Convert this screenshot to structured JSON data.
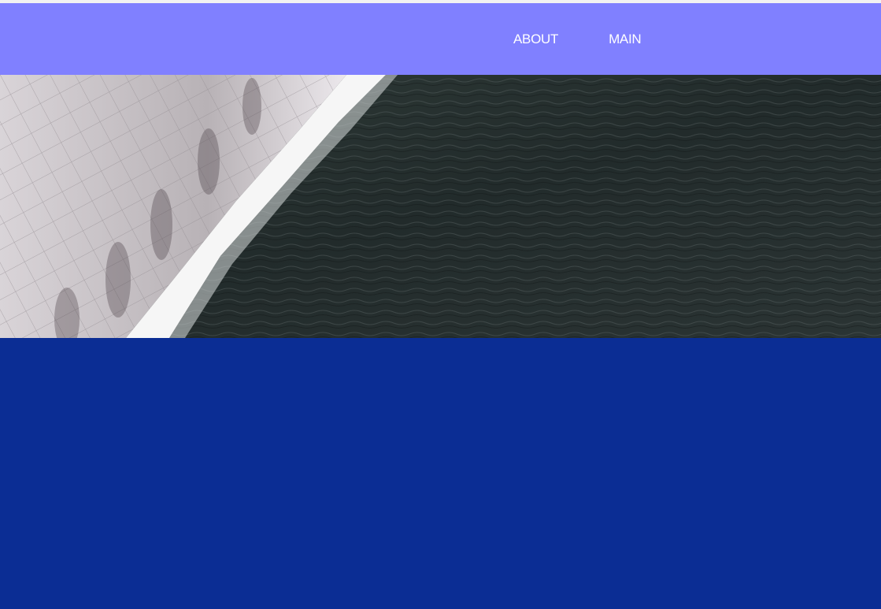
{
  "nav": {
    "items": [
      {
        "label": "ABOUT"
      },
      {
        "label": "MAIN"
      }
    ]
  },
  "hero": {
    "image": "waterfall-pool-photo"
  },
  "colors": {
    "header_bg": "#8080ff",
    "nav_text": "#ffffff",
    "lower_section_bg": "#0b2d94"
  }
}
